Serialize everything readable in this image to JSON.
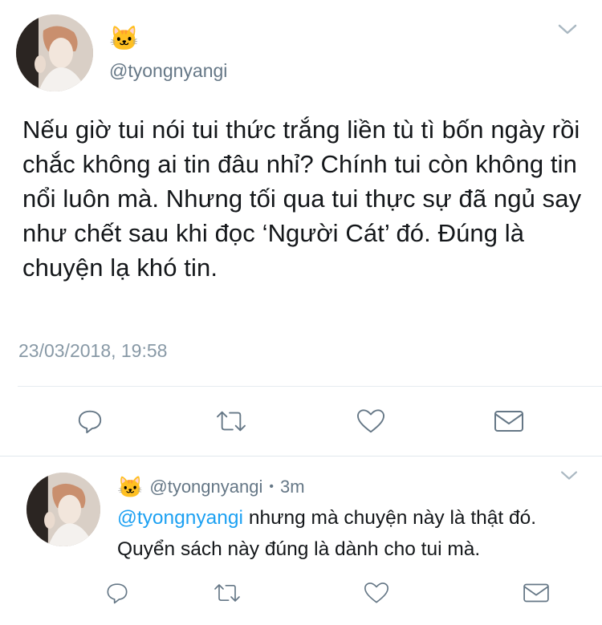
{
  "main_tweet": {
    "emoji": "🐱",
    "handle": "@tyongnyangi",
    "text": "Nếu giờ tui nói tui thức trắng liền tù tì bốn ngày rồi chắc không ai tin đâu nhỉ? Chính tui còn không tin nổi luôn mà. Nhưng tối qua tui thực sự đã ngủ say như chết sau khi đọc ‘Người Cát’ đó. Đúng là chuyện lạ khó tin.",
    "timestamp": "23/03/2018, 19:58",
    "icons": [
      "chevron-down-icon",
      "reply-icon",
      "retweet-icon",
      "like-icon",
      "message-icon"
    ]
  },
  "reply_tweet": {
    "emoji": "🐱",
    "handle": "@tyongnyangi",
    "separator": "•",
    "time_ago": "3m",
    "mention": "@tyongnyangi",
    "text": " nhưng mà chuyện này là thật đó. Quyển sách này đúng là dành cho tui mà.",
    "icons": [
      "chevron-down-icon",
      "reply-icon",
      "retweet-icon",
      "like-icon",
      "message-icon"
    ]
  },
  "colors": {
    "text": "#14171a",
    "secondary": "#657786",
    "timestamp": "#8899a6",
    "mention": "#1da1f2",
    "divider": "#e6ecf0"
  }
}
